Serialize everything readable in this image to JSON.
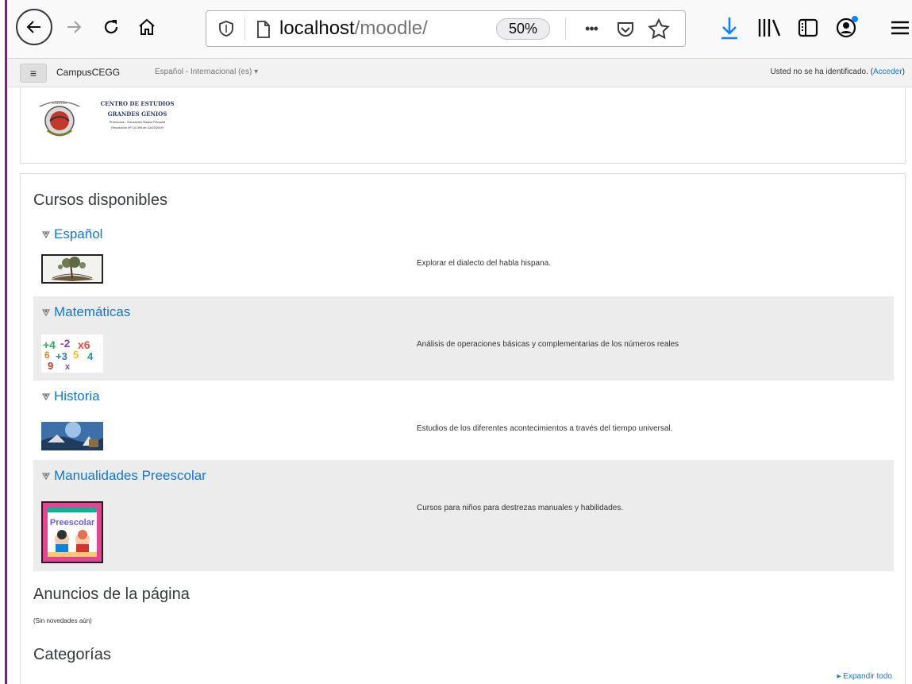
{
  "browser": {
    "url_host": "localhost",
    "url_path": "/moodle/",
    "zoom": "50%",
    "more_label": "•••"
  },
  "navbar": {
    "menu_icon": "≡",
    "brand": "CampusCEGG",
    "language": "Español - Internacional (es) ▾",
    "login_text": "Usted no se ha identificado. (",
    "login_link": "Acceder",
    "login_close": ")"
  },
  "logo": {
    "line1": "CENTRO DE ESTUDIOS",
    "line2": "GRANDES GENIOS",
    "line3": "Preescolar - Educación Básica Primaria",
    "line4": "Resolución Nº 10-099 de 31/03/2009",
    "seal_text": "COLEGIO"
  },
  "main": {
    "courses_title": "Cursos disponibles",
    "courses": [
      {
        "name": "Español",
        "summary": "Explorar el dialecto del habla hispana."
      },
      {
        "name": "Matemáticas",
        "summary": "Análisis de operaciones básicas y complementarias de los números reales"
      },
      {
        "name": "Historia",
        "summary": "Estudios de los diferentes acontecimientos a través del tiempo universal."
      },
      {
        "name": "Manualidades Preescolar",
        "summary": "Cursos para niños para destrezas manuales y habilidades."
      }
    ],
    "math_digits": [
      "+4",
      "-2",
      "x6",
      "6",
      "+3",
      "5",
      "4",
      "9",
      "x"
    ],
    "preescolar_label": "Preescolar",
    "news_title": "Anuncios de la página",
    "no_news": "(Sin novedades aún)",
    "categories_title": "Categorías",
    "expand_all": "▸ Expandir todo"
  }
}
